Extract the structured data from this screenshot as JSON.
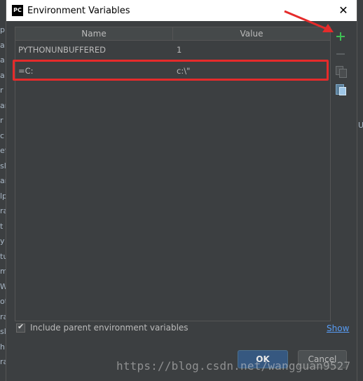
{
  "window": {
    "title": "Environment Variables",
    "app_icon_text": "PC",
    "close_glyph": "✕"
  },
  "table": {
    "columns": [
      "Name",
      "Value"
    ],
    "rows": [
      {
        "name": "PYTHONUNBUFFERED",
        "value": "1"
      },
      {
        "name": "=C:",
        "value": "c:\\\""
      }
    ]
  },
  "toolbar": {
    "add_icon": "plus-icon",
    "remove_icon": "minus-icon",
    "copy_icon": "copy-icon",
    "paste_icon": "paste-icon"
  },
  "options": {
    "include_parent_label": "Include parent environment variables",
    "include_parent_checked": true,
    "show_link": "Show"
  },
  "buttons": {
    "ok": "OK",
    "cancel": "Cancel"
  },
  "background_left_letters": [
    "p",
    "a",
    "a",
    "a",
    "r",
    "ar",
    "r",
    "c",
    "ef",
    "sl",
    "ar",
    "lp",
    "ra",
    "t",
    "y",
    "tu",
    "m",
    "W.",
    "ot",
    "ra",
    "sl",
    "h",
    "ra"
  ],
  "background_right_letters": [
    "U"
  ],
  "watermark": "https://blog.csdn.net/wangguan9527",
  "colors": {
    "dialog_bg": "#3c3f41",
    "highlight": "#e52b2b",
    "add_green": "#3fbf55",
    "link_blue": "#589df6",
    "ok_button": "#365880"
  }
}
